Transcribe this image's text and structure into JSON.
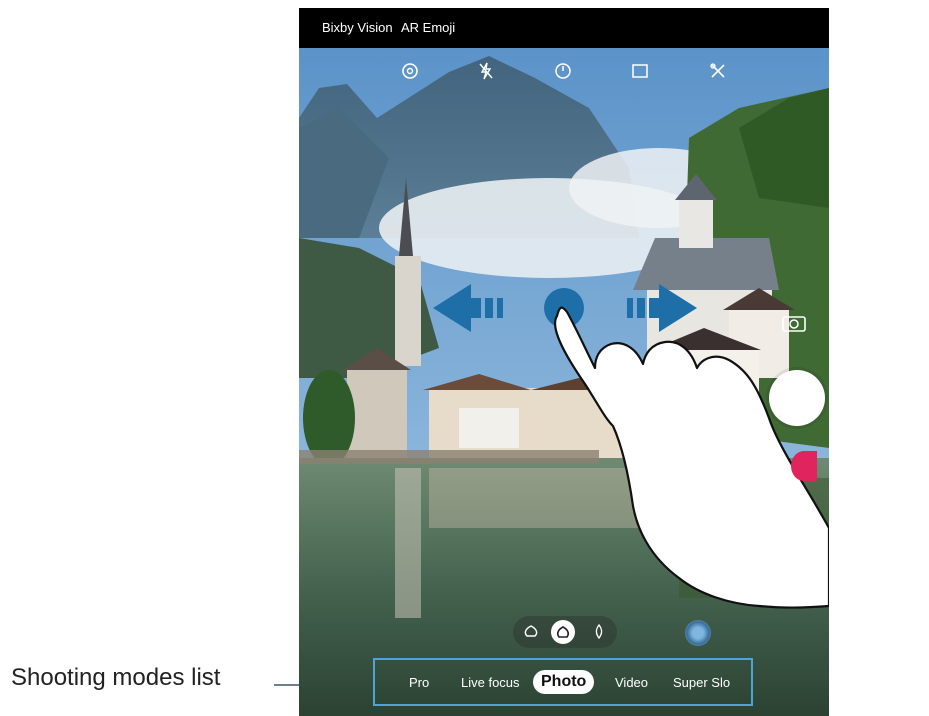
{
  "callout": {
    "label": "Shooting modes list"
  },
  "top_bar": {
    "left_item": "Bixby Vision",
    "right_item": "AR Emoji"
  },
  "settings": {
    "icons": [
      "settings-icon",
      "flash-off-icon",
      "timer-off-icon",
      "aspect-ratio-icon",
      "filters-icon"
    ]
  },
  "side_controls": {
    "icons": [
      "switch-camera-icon",
      "shutter-button",
      "record-button"
    ]
  },
  "effects": {
    "icons": [
      "effect-left-icon",
      "effect-center-icon",
      "effect-right-icon"
    ],
    "gallery_icon": "gallery-thumbnail"
  },
  "modes": [
    "Pro",
    "Live focus",
    "Photo",
    "Video",
    "Super Slo"
  ],
  "selected_mode": "Photo",
  "gesture": {
    "icon": "swipe-hand-icon",
    "arrows": [
      "arrow-left-icon",
      "arrow-right-icon"
    ]
  },
  "colors": {
    "accent": "#1e6fa8",
    "highlight_box": "#4ea4d9",
    "record": "#e0245e"
  }
}
